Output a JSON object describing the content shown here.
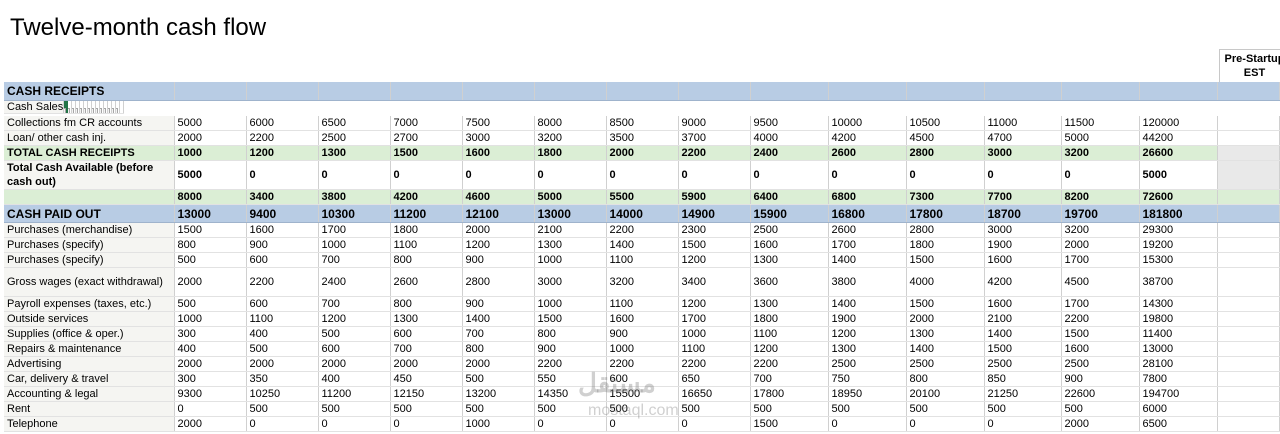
{
  "title": "Twelve-month cash flow",
  "prestartup": {
    "line1": "Pre-Startup",
    "line2": "EST"
  },
  "rows": [
    {
      "type": "sec",
      "label": "CASH RECEIPTS",
      "values": [
        "",
        "",
        "",
        "",
        "",
        "",
        "",
        "",
        "",
        "",
        "",
        "",
        "",
        ""
      ]
    },
    {
      "type": "dd",
      "label": "Cash Sales",
      "values": [
        "",
        "",
        "",
        "",
        "",
        "",
        "",
        "",
        "",
        "",
        "",
        "",
        "",
        ""
      ]
    },
    {
      "type": "data",
      "label": "Collections fm CR accounts",
      "values": [
        "5000",
        "6000",
        "6500",
        "7000",
        "7500",
        "8000",
        "8500",
        "9000",
        "9500",
        "10000",
        "10500",
        "11000",
        "11500",
        "120000"
      ]
    },
    {
      "type": "data",
      "label": "Loan/ other cash inj.",
      "values": [
        "2000",
        "2200",
        "2500",
        "2700",
        "3000",
        "3200",
        "3500",
        "3700",
        "4000",
        "4200",
        "4500",
        "4700",
        "5000",
        "44200"
      ]
    },
    {
      "type": "tot",
      "label": "TOTAL CASH RECEIPTS",
      "values": [
        "1000",
        "1200",
        "1300",
        "1500",
        "1600",
        "1800",
        "2000",
        "2200",
        "2400",
        "2600",
        "2800",
        "3000",
        "3200",
        "26600"
      ]
    },
    {
      "type": "avail",
      "label": "Total Cash Available (before cash out)",
      "values": [
        "5000",
        "0",
        "0",
        "0",
        "0",
        "0",
        "0",
        "0",
        "0",
        "0",
        "0",
        "0",
        "0",
        "5000"
      ]
    },
    {
      "type": "grn",
      "label": "",
      "values": [
        "8000",
        "3400",
        "3800",
        "4200",
        "4600",
        "5000",
        "5500",
        "5900",
        "6400",
        "6800",
        "7300",
        "7700",
        "8200",
        "72600"
      ]
    },
    {
      "type": "sec",
      "label": "CASH PAID OUT",
      "values": [
        "13000",
        "9400",
        "10300",
        "11200",
        "12100",
        "13000",
        "14000",
        "14900",
        "15900",
        "16800",
        "17800",
        "18700",
        "19700",
        "181800"
      ]
    },
    {
      "type": "data",
      "label": "Purchases (merchandise)",
      "values": [
        "1500",
        "1600",
        "1700",
        "1800",
        "2000",
        "2100",
        "2200",
        "2300",
        "2500",
        "2600",
        "2800",
        "3000",
        "3200",
        "29300"
      ]
    },
    {
      "type": "data",
      "label": "Purchases (specify)",
      "values": [
        "800",
        "900",
        "1000",
        "1100",
        "1200",
        "1300",
        "1400",
        "1500",
        "1600",
        "1700",
        "1800",
        "1900",
        "2000",
        "19200"
      ]
    },
    {
      "type": "data",
      "label": "Purchases (specify)",
      "values": [
        "500",
        "600",
        "700",
        "800",
        "900",
        "1000",
        "1100",
        "1200",
        "1300",
        "1400",
        "1500",
        "1600",
        "1700",
        "15300"
      ]
    },
    {
      "type": "tall",
      "label": "Gross wages (exact withdrawal)",
      "values": [
        "2000",
        "2200",
        "2400",
        "2600",
        "2800",
        "3000",
        "3200",
        "3400",
        "3600",
        "3800",
        "4000",
        "4200",
        "4500",
        "38700"
      ]
    },
    {
      "type": "data",
      "label": "Payroll expenses (taxes, etc.)",
      "values": [
        "500",
        "600",
        "700",
        "800",
        "900",
        "1000",
        "1100",
        "1200",
        "1300",
        "1400",
        "1500",
        "1600",
        "1700",
        "14300"
      ]
    },
    {
      "type": "data",
      "label": "Outside services",
      "values": [
        "1000",
        "1100",
        "1200",
        "1300",
        "1400",
        "1500",
        "1600",
        "1700",
        "1800",
        "1900",
        "2000",
        "2100",
        "2200",
        "19800"
      ]
    },
    {
      "type": "data",
      "label": "Supplies (office & oper.)",
      "values": [
        "300",
        "400",
        "500",
        "600",
        "700",
        "800",
        "900",
        "1000",
        "1100",
        "1200",
        "1300",
        "1400",
        "1500",
        "11400"
      ]
    },
    {
      "type": "data",
      "label": "Repairs & maintenance",
      "values": [
        "400",
        "500",
        "600",
        "700",
        "800",
        "900",
        "1000",
        "1100",
        "1200",
        "1300",
        "1400",
        "1500",
        "1600",
        "13000"
      ]
    },
    {
      "type": "data",
      "label": "Advertising",
      "values": [
        "2000",
        "2000",
        "2000",
        "2000",
        "2000",
        "2200",
        "2200",
        "2200",
        "2200",
        "2500",
        "2500",
        "2500",
        "2500",
        "28100"
      ]
    },
    {
      "type": "data",
      "label": "Car, delivery & travel",
      "values": [
        "300",
        "350",
        "400",
        "450",
        "500",
        "550",
        "600",
        "650",
        "700",
        "750",
        "800",
        "850",
        "900",
        "7800"
      ]
    },
    {
      "type": "data",
      "label": "Accounting & legal",
      "values": [
        "9300",
        "10250",
        "11200",
        "12150",
        "13200",
        "14350",
        "15500",
        "16650",
        "17800",
        "18950",
        "20100",
        "21250",
        "22600",
        "194700"
      ]
    },
    {
      "type": "data",
      "label": "Rent",
      "values": [
        "0",
        "500",
        "500",
        "500",
        "500",
        "500",
        "500",
        "500",
        "500",
        "500",
        "500",
        "500",
        "500",
        "6000"
      ]
    },
    {
      "type": "data",
      "label": "Telephone",
      "values": [
        "2000",
        "0",
        "0",
        "0",
        "1000",
        "0",
        "0",
        "0",
        "1500",
        "0",
        "0",
        "0",
        "2000",
        "6500"
      ]
    }
  ],
  "watermark": {
    "line1": "مستقل",
    "line2": "mostaql.com"
  }
}
